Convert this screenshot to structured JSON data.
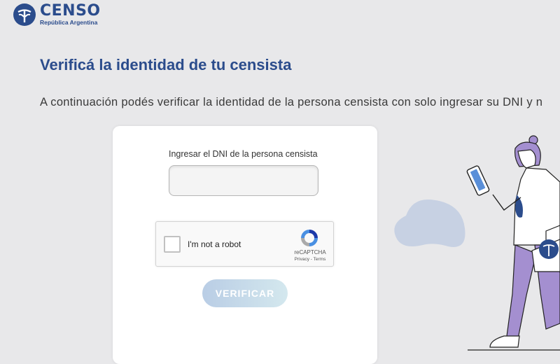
{
  "header": {
    "logo_title": "CENSO",
    "logo_subtitle": "República Argentina",
    "logo_icon": "censo-logo-icon"
  },
  "main": {
    "title": "Verificá la identidad de tu censista",
    "intro": "A continuación podés verificar la identidad de la persona censista con solo ingresar su DNI y n"
  },
  "form": {
    "dni_label": "Ingresar el DNI de la persona censista",
    "dni_value": "",
    "recaptcha_label": "I'm not a robot",
    "recaptcha_brand": "reCAPTCHA",
    "recaptcha_links": "Privacy - Terms",
    "verify_label": "VERIFICAR"
  },
  "colors": {
    "brand": "#2b4c8c",
    "background": "#e8e8ea",
    "illustration_purple": "#a48fd0",
    "illustration_blob": "#c7d1e3"
  }
}
